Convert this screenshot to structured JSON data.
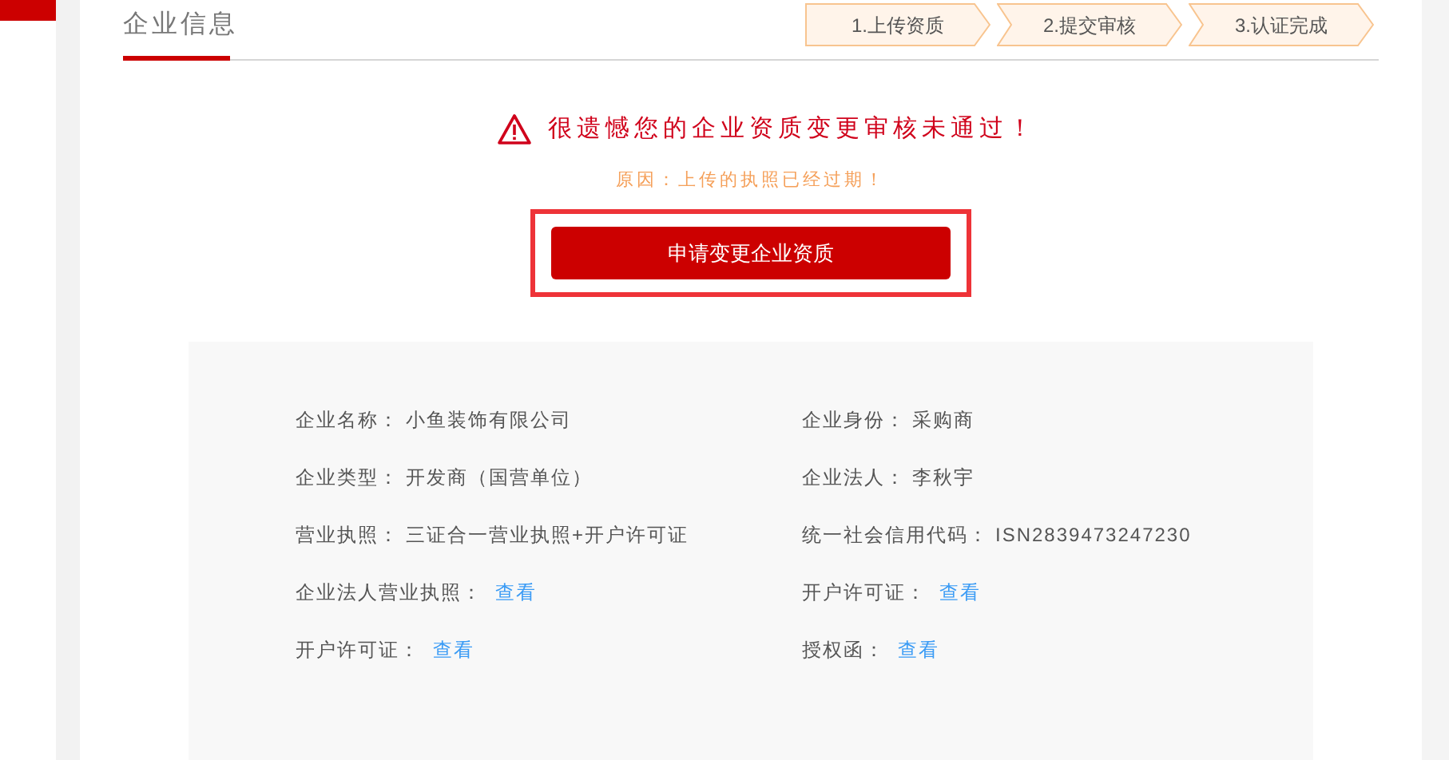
{
  "title": "企业信息",
  "steps": [
    {
      "label": "1.上传资质"
    },
    {
      "label": "2.提交审核"
    },
    {
      "label": "3.认证完成"
    }
  ],
  "alert": {
    "message": "很遗憾您的企业资质变更审核未通过！",
    "reason": "原因：上传的执照已经过期！",
    "button": "申请变更企业资质"
  },
  "fields": [
    {
      "kind": "text",
      "label": "企业名称：",
      "value": "小鱼装饰有限公司"
    },
    {
      "kind": "text",
      "label": "企业身份：",
      "value": "采购商"
    },
    {
      "kind": "text",
      "label": "企业类型：",
      "value": "开发商（国营单位）"
    },
    {
      "kind": "text",
      "label": "企业法人：",
      "value": "李秋宇"
    },
    {
      "kind": "text",
      "label": "营业执照：",
      "value": "三证合一营业执照+开户许可证"
    },
    {
      "kind": "text",
      "label": "统一社会信用代码：",
      "value": "ISN2839473247230"
    },
    {
      "kind": "link",
      "label": "企业法人营业执照：",
      "value": "查看"
    },
    {
      "kind": "link",
      "label": "开户许可证：",
      "value": "查看"
    },
    {
      "kind": "link",
      "label": "开户许可证：",
      "value": "查看"
    },
    {
      "kind": "link",
      "label": "授权函：",
      "value": "查看"
    }
  ]
}
